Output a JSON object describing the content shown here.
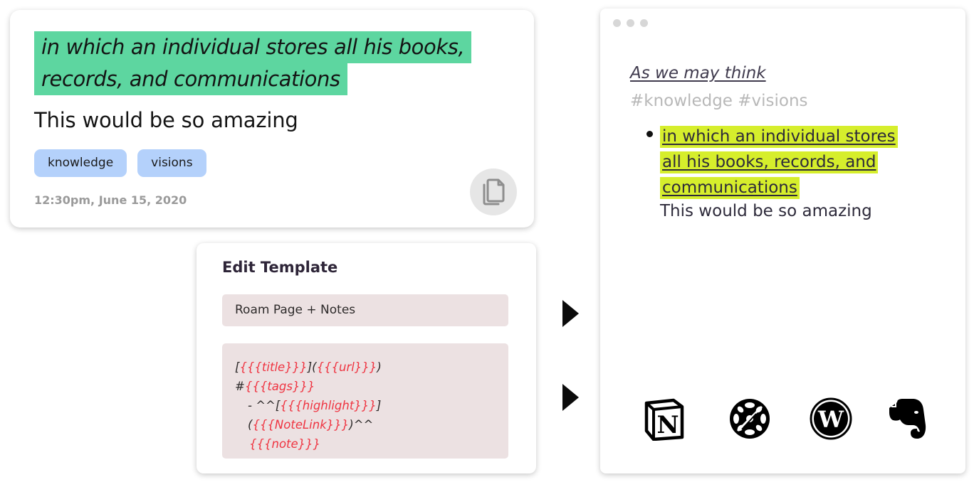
{
  "highlight_card": {
    "quote_line1": "in which an individual stores all his books,",
    "quote_line2": "records, and communications",
    "note": "This would be so amazing",
    "tags": [
      "knowledge",
      "visions"
    ],
    "timestamp": "12:30pm, June 15, 2020",
    "copy_icon": "copy-icon",
    "highlight_color": "#5dd6a0",
    "tag_color": "#b4d1fb"
  },
  "template_card": {
    "title": "Edit Template",
    "selected_template": "Roam Page + Notes",
    "code": {
      "l1_a": "[",
      "l1_v1": "{{{title}}}",
      "l1_b": "](",
      "l1_v2": "{{{url}}}",
      "l1_c": ")",
      "l2_a": "#",
      "l2_v": "{{{tags}}}",
      "l3_a": "- ^^[",
      "l3_v1": "{{{highlight}}}",
      "l3_b": "](",
      "l3_v2": "{{{NoteLink}}}",
      "l3_c": ")^^",
      "l4_v": "{{{note}}}"
    },
    "variable_color": "#ef3340",
    "background_color": "#ece1e2"
  },
  "output_window": {
    "title": "As we may think",
    "tags_line": "#knowledge #visions",
    "highlight_lines": [
      "in which an individual stores",
      "all his books, records, and",
      "communications"
    ],
    "note": "This would be so amazing",
    "highlight_color": "#d6ee2c",
    "integrations": [
      "notion-icon",
      "roam-research-icon",
      "wordpress-icon",
      "evernote-icon"
    ]
  }
}
